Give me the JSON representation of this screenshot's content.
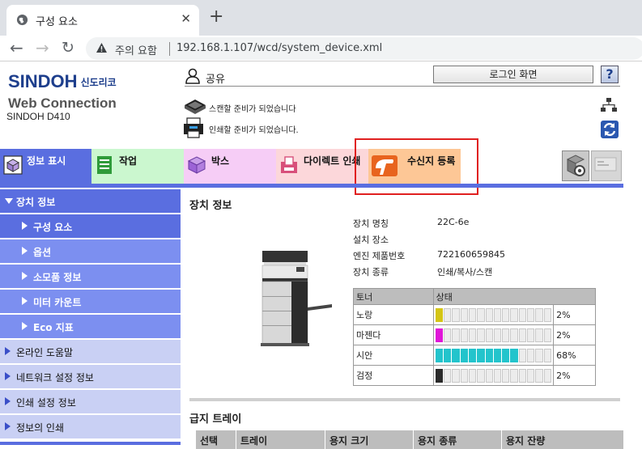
{
  "browser": {
    "tab_title": "구성 요소",
    "tab_close": "✕",
    "new_tab": "+",
    "security_warning": "주의 요함",
    "url": "192.168.1.107/wcd/system_device.xml"
  },
  "header": {
    "logo_brand": "SINDOH",
    "logo_korean": "신도리코",
    "product_name": "Web Connection",
    "model": "SINDOH D410",
    "user_name": "공유",
    "login_button": "로그인 화면",
    "help_button": "?",
    "scan_status": "스캔할 준비가 되었습니다",
    "print_status": "인쇄할 준비가 되었습니다."
  },
  "main_tabs": [
    {
      "label": "정보 표시",
      "icon": "info-display-icon",
      "color": "#5a6ee0"
    },
    {
      "label": "작업",
      "icon": "job-icon",
      "color": "#cbf7cf"
    },
    {
      "label": "박스",
      "icon": "box-icon",
      "color": "#f6cdf6"
    },
    {
      "label": "다이렉트 인쇄",
      "icon": "direct-print-icon",
      "color": "#fcd7da"
    },
    {
      "label": "수신지 등록",
      "icon": "address-register-icon",
      "color": "#fdc796"
    }
  ],
  "sidebar": {
    "items": [
      {
        "label": "장치 정보",
        "level": "top"
      },
      {
        "label": "구성 요소",
        "level": "sub",
        "active": true
      },
      {
        "label": "옵션",
        "level": "sub"
      },
      {
        "label": "소모품 정보",
        "level": "sub"
      },
      {
        "label": "미터 카운트",
        "level": "sub"
      },
      {
        "label": "Eco 지표",
        "level": "sub"
      },
      {
        "label": "온라인 도움말",
        "level": "plain"
      },
      {
        "label": "네트워크 설정 정보",
        "level": "plain"
      },
      {
        "label": "인쇄 설정 정보",
        "level": "plain"
      },
      {
        "label": "정보의 인쇄",
        "level": "plain"
      }
    ]
  },
  "device_info": {
    "section_title": "장치 정보",
    "fields": [
      {
        "label": "장치 명칭",
        "value": "22C-6e"
      },
      {
        "label": "설치 장소",
        "value": ""
      },
      {
        "label": "엔진 제품번호",
        "value": "722160659845"
      },
      {
        "label": "장치 종류",
        "value": "인쇄/복사/스캔"
      }
    ]
  },
  "toner": {
    "header_toner": "토너",
    "header_status": "상태",
    "rows": [
      {
        "name": "노랑",
        "percent": "2%",
        "level": 2,
        "color": "#d4c516"
      },
      {
        "name": "마젠다",
        "percent": "2%",
        "level": 2,
        "color": "#e016d8"
      },
      {
        "name": "시안",
        "percent": "68%",
        "level": 68,
        "color": "#23c4cc"
      },
      {
        "name": "검정",
        "percent": "2%",
        "level": 2,
        "color": "#2a2a2a"
      }
    ]
  },
  "paper_tray": {
    "section_title": "급지 트레이",
    "columns": [
      "선택",
      "트레이",
      "용지 크기",
      "용지 종류",
      "용지 잔량"
    ]
  }
}
